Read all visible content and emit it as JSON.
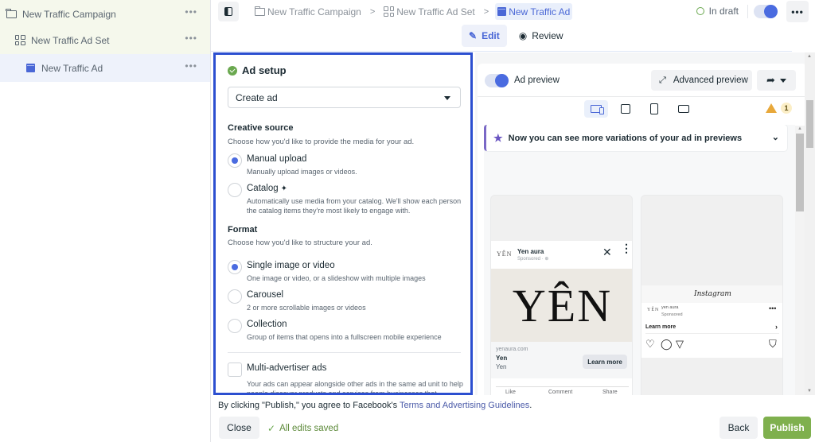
{
  "sidebar": {
    "items": [
      {
        "label": "New Traffic Campaign",
        "icon": "folder-icon",
        "more": "•••"
      },
      {
        "label": "New Traffic Ad Set",
        "icon": "grid-icon",
        "more": "•••"
      },
      {
        "label": "New Traffic Ad",
        "icon": "ad-icon",
        "more": "•••",
        "selected": true
      }
    ]
  },
  "topbar": {
    "breadcrumbs": [
      {
        "label": "New Traffic Campaign",
        "icon": "folder-icon"
      },
      {
        "label": "New Traffic Ad Set",
        "icon": "grid-icon"
      },
      {
        "label": "New Traffic Ad",
        "icon": "ad-icon",
        "active": true
      }
    ],
    "separator": ">",
    "status": "In draft",
    "toggle_on": true,
    "more": "•••"
  },
  "tabs": [
    {
      "label": "Edit",
      "icon": "pencil-icon",
      "active": true
    },
    {
      "label": "Review",
      "icon": "eye-icon"
    }
  ],
  "ad_setup": {
    "title": "Ad setup",
    "select_value": "Create ad",
    "creative_source": {
      "heading": "Creative source",
      "subtitle": "Choose how you'd like to provide the media for your ad.",
      "options": [
        {
          "label": "Manual upload",
          "desc": "Manually upload images or videos.",
          "checked": true
        },
        {
          "label": "Catalog",
          "desc": "Automatically use media from your catalog. We'll show each person the catalog items they're most likely to engage with.",
          "checked": false,
          "sparkle": "✦"
        }
      ]
    },
    "format": {
      "heading": "Format",
      "subtitle": "Choose how you'd like to structure your ad.",
      "options": [
        {
          "label": "Single image or video",
          "desc": "One image or video, or a slideshow with multiple images",
          "checked": true
        },
        {
          "label": "Carousel",
          "desc": "2 or more scrollable images or videos",
          "checked": false
        },
        {
          "label": "Collection",
          "desc": "Group of items that opens into a fullscreen mobile experience",
          "checked": false
        }
      ]
    },
    "multi_advertiser": {
      "label": "Multi-advertiser ads",
      "desc": "Your ads can appear alongside other ads in the same ad unit to help people discover products and services from businesses that",
      "checked": false
    }
  },
  "preview": {
    "toggle_label": "Ad preview",
    "toggle_on": true,
    "advanced_label": "Advanced preview",
    "warning_count": "1",
    "notice": "Now you can see more variations of your ad in previews",
    "facebook": {
      "logo_mini": "YÊN",
      "page_name": "Yen aura",
      "sponsored": "Sponsored · ⊕",
      "image_text": "YÊN",
      "domain": "yenaura.com",
      "headline": "Yen",
      "description": "Yen",
      "cta": "Learn more",
      "actions": [
        "Like",
        "Comment",
        "Share"
      ]
    },
    "instagram": {
      "brand": "Instagram",
      "logo_mini": "YÊN",
      "account": "yen aura",
      "sponsored": "Sponsored",
      "cta": "Learn more"
    }
  },
  "footer": {
    "terms_prefix": "By clicking \"Publish,\" you agree to Facebook's ",
    "terms_link": "Terms and Advertising Guidelines",
    "terms_suffix": ".",
    "close": "Close",
    "saved": "All edits saved",
    "back": "Back",
    "publish": "Publish"
  },
  "colors": {
    "accent": "#4a67d6",
    "focus_border": "#2c4fd0",
    "publish": "#7fb04e",
    "success": "#6aa84f",
    "warning": "#e8a83a",
    "notice_accent": "#7a68c6"
  }
}
